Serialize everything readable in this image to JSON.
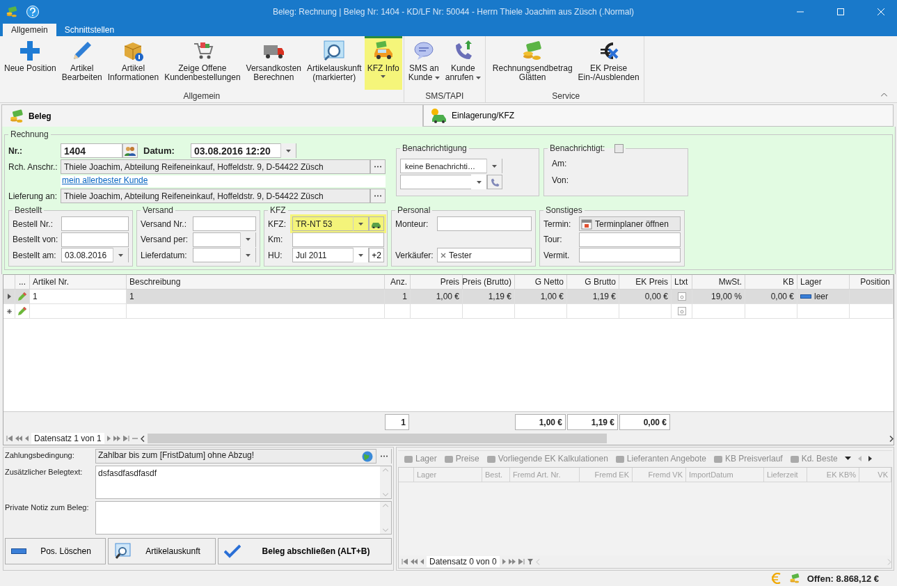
{
  "window": {
    "title": "Beleg: Rechnung | Beleg Nr: 1404 -  KD/LF Nr: 50044 - Herrn Thiele Joachim aus Züsch (.Normal)"
  },
  "ribbon_tabs": [
    {
      "label": "Allgemein",
      "selected": true
    },
    {
      "label": "Schnittstellen",
      "selected": false
    }
  ],
  "ribbon_groups": [
    {
      "label": "Allgemein",
      "buttons": [
        {
          "label": "Neue Position",
          "dropdown": false,
          "highlighted": false
        },
        {
          "label": "Artikel\nBearbeiten",
          "dropdown": false,
          "highlighted": false
        },
        {
          "label": "Artikel\nInformationen",
          "dropdown": false,
          "highlighted": false
        },
        {
          "label": "Zeige Offene\nKundenbestellungen",
          "dropdown": false,
          "highlighted": false
        },
        {
          "label": "Versandkosten\nBerechnen",
          "dropdown": false,
          "highlighted": false
        },
        {
          "label": "Artikelauskunft\n(markierter)",
          "dropdown": false,
          "highlighted": false
        },
        {
          "label": "KFZ Info",
          "dropdown": true,
          "highlighted": true
        }
      ]
    },
    {
      "label": "SMS/TAPI",
      "buttons": [
        {
          "label": "SMS an\nKunde",
          "dropdown": true,
          "highlighted": false
        },
        {
          "label": "Kunde\nanrufen",
          "dropdown": true,
          "highlighted": false
        }
      ]
    },
    {
      "label": "Service",
      "buttons": [
        {
          "label": "Rechnungsendbetrag\nGlätten",
          "dropdown": false,
          "highlighted": false
        },
        {
          "label": "EK Preise\nEin-/Ausblenden",
          "dropdown": false,
          "highlighted": false
        }
      ]
    }
  ],
  "doc_tabs": [
    {
      "label": "Beleg",
      "selected": true
    },
    {
      "label": "Einlagerung/KFZ",
      "selected": false
    }
  ],
  "rechnung": {
    "title": "Rechnung",
    "nr": {
      "label": "Nr.:",
      "value": "1404"
    },
    "datum": {
      "label": "Datum:",
      "value": "03.08.2016 12:20"
    },
    "anschrift": {
      "label": "Rch. Anschr.:",
      "value": "Thiele Joachim, Abteilung Reifeneinkauf, Hoffeldstr. 9,  D-54422 Züsch"
    },
    "kunde_link": "mein allerbester Kunde",
    "lieferung": {
      "label": "Lieferung an:",
      "value": "Thiele Joachim, Abteilung Reifeneinkauf, Hoffeldstr. 9,  D-54422 Züsch"
    }
  },
  "benachrichtigung": {
    "title": "Benachrichtigung",
    "value": "keine Benachrichti…"
  },
  "benachrichtigt": {
    "title": "Benachrichtigt:",
    "checked": false,
    "labels": [
      "Am:",
      "Von:"
    ]
  },
  "sub_groups": [
    {
      "title": "Bestellt",
      "fields": [
        {
          "label": "Bestell Nr.:",
          "kind": "text"
        },
        {
          "label": "Bestellt von:",
          "kind": "text"
        },
        {
          "label": "Bestellt am:",
          "kind": "combo",
          "value": "03.08.2016"
        }
      ]
    },
    {
      "title": "Versand",
      "fields": [
        {
          "label": "Versand Nr.:",
          "kind": "text"
        },
        {
          "label": "Versand per:",
          "kind": "combo"
        },
        {
          "label": "Lieferdatum:",
          "kind": "combo"
        }
      ]
    },
    {
      "title": "KFZ",
      "fields": [
        {
          "label": "KFZ:",
          "kind": "combo_add",
          "value": "TR-NT 53",
          "highlighted": true
        },
        {
          "label": "Km:",
          "kind": "text",
          "highlighted": false
        },
        {
          "label": "HU:",
          "kind": "combo_button",
          "value": "Jul 2011",
          "button": "+2"
        }
      ]
    },
    {
      "title": "Personal",
      "fields": [
        {
          "label": "Monteur:",
          "kind": "text"
        },
        {
          "label": "Verkäufer:",
          "kind": "token",
          "value": "Tester"
        }
      ]
    },
    {
      "title": "Sonstiges",
      "fields": [
        {
          "label": "Termin:",
          "kind": "button",
          "value": "Terminplaner öffnen"
        },
        {
          "label": "Tour:",
          "kind": "text"
        },
        {
          "label": "Vermit.",
          "kind": "text"
        }
      ]
    }
  ],
  "grid": {
    "columns": [
      {
        "label": "..."
      },
      {
        "label": "Artikel Nr."
      },
      {
        "label": "Beschreibung"
      },
      {
        "label": "Anz."
      },
      {
        "label": "Preis"
      },
      {
        "label": "Preis (Brutto)"
      },
      {
        "label": "G Netto"
      },
      {
        "label": "G Brutto"
      },
      {
        "label": "EK Preis"
      },
      {
        "label": "Ltxt"
      },
      {
        "label": "MwSt."
      },
      {
        "label": "KB"
      },
      {
        "label": "Lager"
      },
      {
        "label": "Position"
      }
    ],
    "rows": [
      {
        "current": true,
        "new_row": false,
        "selected": true,
        "artikel_nr": "1",
        "beschreibung": "1",
        "anz": "1",
        "preis": "1,00 €",
        "preis_brutto": "1,19 €",
        "g_netto": "1,00 €",
        "g_brutto": "1,19 €",
        "ek_preis": "0,00 €",
        "mwst": "19,00 %",
        "kb": "0,00 €",
        "lager": "leer"
      },
      {
        "current": false,
        "new_row": true,
        "selected": false
      }
    ],
    "totals": {
      "anz": "1",
      "g_netto": "1,00 €",
      "g_brutto": "1,19 €",
      "ek_preis": "0,00 €"
    },
    "navigator": "Datensatz 1 von 1"
  },
  "bottom": {
    "zahlung": {
      "label": "Zahlungsbedingung:",
      "value": "Zahlbar bis zum [FristDatum] ohne Abzug!"
    },
    "belegtext": {
      "label": "Zusätzlicher Belegtext:",
      "value": "dsfasdfasdfasdf"
    },
    "notiz": {
      "label": "Private Notiz zum Beleg:"
    },
    "buttons": [
      {
        "label": "Pos. Löschen",
        "bold": false
      },
      {
        "label": "Artikelauskunft",
        "bold": false
      },
      {
        "label": "Beleg abschließen (ALT+B)",
        "bold": true
      }
    ]
  },
  "side_panel": {
    "tabs": [
      {
        "label": "Lager",
        "disabled": true
      },
      {
        "label": "Preise",
        "disabled": true
      },
      {
        "label": "Vorliegende EK Kalkulationen",
        "disabled": true
      },
      {
        "label": "Lieferanten Angebote",
        "disabled": true
      },
      {
        "label": "KB Preisverlauf",
        "disabled": true
      },
      {
        "label": "Kd. Beste",
        "disabled": true
      }
    ],
    "columns": [
      {
        "label": "Lager"
      },
      {
        "label": "Best."
      },
      {
        "label": "Fremd Art. Nr."
      },
      {
        "label": "Fremd EK"
      },
      {
        "label": "Fremd VK"
      },
      {
        "label": "ImportDatum"
      },
      {
        "label": "Lieferzeit"
      },
      {
        "label": "EK KB%"
      },
      {
        "label": "VK"
      }
    ],
    "navigator": "Datensatz 0 von 0"
  },
  "status_bar": {
    "offen": "Offen: 8.868,12 €"
  }
}
